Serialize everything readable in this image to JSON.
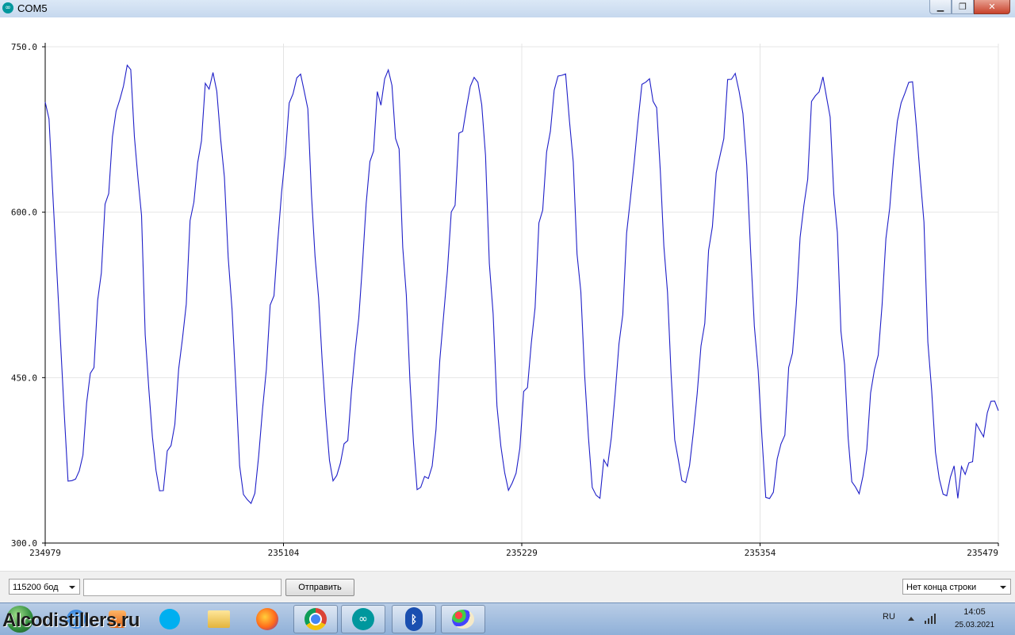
{
  "window": {
    "title": "COM5",
    "icon": "arduino-icon"
  },
  "chart_data": {
    "type": "line",
    "title": "",
    "xlabel": "",
    "ylabel": "",
    "ylim": [
      300,
      750
    ],
    "xlim": [
      234979,
      235479
    ],
    "y_ticks": [
      "750.0",
      "600.0",
      "450.0",
      "300.0"
    ],
    "x_ticks": [
      "234979",
      "235104",
      "235229",
      "235354",
      "235479"
    ],
    "grid": true,
    "series_color": "#1f1fc8",
    "period_samples": 46,
    "peaks_x": [
      235022,
      235067,
      235113,
      235159,
      235204,
      235250,
      235296,
      235341,
      235387,
      235432
    ],
    "peak_y": [
      728,
      722,
      728,
      728,
      728,
      730,
      722,
      724,
      724,
      723
    ],
    "troughs_x": [
      234993,
      235039,
      235085,
      235130,
      235176,
      235222,
      235268,
      235313,
      235359,
      235404,
      235450
    ],
    "trough_y": [
      352,
      350,
      340,
      352,
      347,
      353,
      345,
      352,
      342,
      347,
      350
    ],
    "start_y": 700,
    "end_y": 420
  },
  "bottom": {
    "baud": "115200 бод",
    "send_input_value": "",
    "send_button": "Отправить",
    "line_ending": "Нет конца строки"
  },
  "taskbar": {
    "watermark": "Alcodistillers.ru",
    "items": [
      "start-orb",
      "internet-explorer-icon",
      "media-player-icon",
      "skype-icon",
      "file-explorer-icon",
      "firefox-icon",
      "chrome-icon",
      "arduino-icon",
      "bluetooth-icon",
      "paint-icon"
    ]
  },
  "tray": {
    "lang": "RU",
    "time": "14:05",
    "date": "25.03.2021"
  }
}
